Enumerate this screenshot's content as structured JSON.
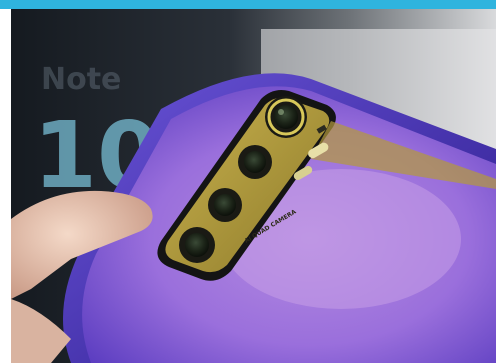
{
  "top_bar": {
    "color": "#2fb4de"
  },
  "photo": {
    "box_text": {
      "word": "Note",
      "number": "10"
    },
    "camera_label": "AI QUAD CAMERA",
    "colors": {
      "phone_back": "#8f63d8",
      "phone_frame": "#4a2fae",
      "camera_module": "#b49a3c",
      "lens_ring": "#d8c85a",
      "box": "#20262c"
    }
  }
}
